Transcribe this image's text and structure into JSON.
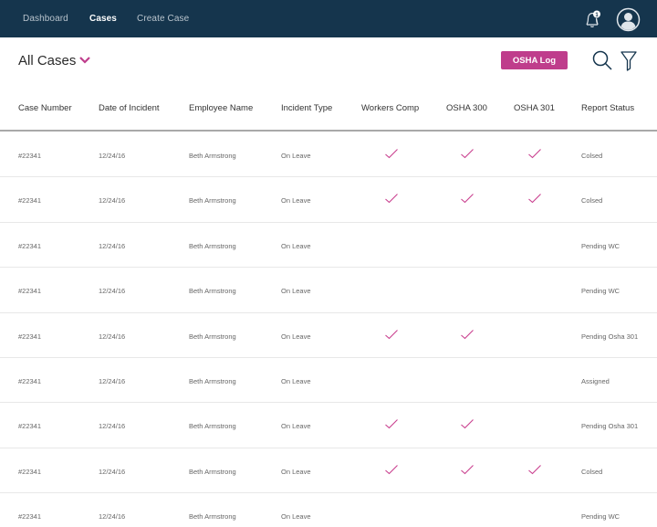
{
  "nav": {
    "items": [
      {
        "label": "Dashboard",
        "active": false
      },
      {
        "label": "Cases",
        "active": true
      },
      {
        "label": "Create Case",
        "active": false
      }
    ],
    "notification_count": "1",
    "bell_icon": "bell-icon",
    "avatar_icon": "user-avatar-icon"
  },
  "header": {
    "title": "All Cases",
    "osha_log_label": "OSHA Log",
    "accent_color": "#bf3d8c",
    "nav_color": "#15354d"
  },
  "table": {
    "columns": [
      "Case Number",
      "Date of Incident",
      "Employee Name",
      "Incident Type",
      "Workers Comp",
      "OSHA 300",
      "OSHA 301",
      "Report Status"
    ],
    "rows": [
      {
        "case": "#22341",
        "date": "12/24/16",
        "name": "Beth Armstrong",
        "type": "On Leave",
        "wc": true,
        "osha300": true,
        "osha301": true,
        "status": "Colsed"
      },
      {
        "case": "#22341",
        "date": "12/24/16",
        "name": "Beth Armstrong",
        "type": "On Leave",
        "wc": true,
        "osha300": true,
        "osha301": true,
        "status": "Colsed"
      },
      {
        "case": "#22341",
        "date": "12/24/16",
        "name": "Beth Armstrong",
        "type": "On Leave",
        "wc": false,
        "osha300": false,
        "osha301": false,
        "status": "Pending WC"
      },
      {
        "case": "#22341",
        "date": "12/24/16",
        "name": "Beth Armstrong",
        "type": "On Leave",
        "wc": false,
        "osha300": false,
        "osha301": false,
        "status": "Pending WC"
      },
      {
        "case": "#22341",
        "date": "12/24/16",
        "name": "Beth Armstrong",
        "type": "On Leave",
        "wc": true,
        "osha300": true,
        "osha301": false,
        "status": "Pending Osha 301"
      },
      {
        "case": "#22341",
        "date": "12/24/16",
        "name": "Beth Armstrong",
        "type": "On Leave",
        "wc": false,
        "osha300": false,
        "osha301": false,
        "status": "Assigned"
      },
      {
        "case": "#22341",
        "date": "12/24/16",
        "name": "Beth Armstrong",
        "type": "On Leave",
        "wc": true,
        "osha300": true,
        "osha301": false,
        "status": "Pending Osha 301"
      },
      {
        "case": "#22341",
        "date": "12/24/16",
        "name": "Beth Armstrong",
        "type": "On Leave",
        "wc": true,
        "osha300": true,
        "osha301": true,
        "status": "Colsed"
      },
      {
        "case": "#22341",
        "date": "12/24/16",
        "name": "Beth Armstrong",
        "type": "On Leave",
        "wc": false,
        "osha300": false,
        "osha301": false,
        "status": "Pending WC"
      }
    ]
  }
}
